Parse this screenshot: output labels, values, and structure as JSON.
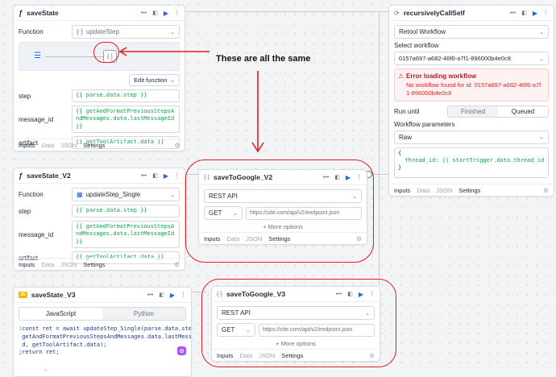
{
  "cards": {
    "saveState": {
      "title": "saveState",
      "function_label": "Function",
      "function_value": "updateStep",
      "edit_function": "Edit function →",
      "rows": [
        {
          "label": "step",
          "value": "{{ parse.data.step }}"
        },
        {
          "label": "message_id",
          "value": "{{ getAndFormatPreviousStepsAndMessages.data.lastMessageId }}"
        },
        {
          "label": "artifact",
          "value": "{{ getToolArtifact.data }}"
        }
      ]
    },
    "saveState_V2": {
      "title": "saveState_V2",
      "function_label": "Function",
      "function_value": "updateStep_Single",
      "rows": [
        {
          "label": "step",
          "value": "{{ parse.data.step }}"
        },
        {
          "label": "message_id",
          "value": "{{ getAndFormatPreviousStepsAndMessages.data.lastMessageId }}"
        },
        {
          "label": "artifact",
          "value": "{{ getToolArtifact.data }}"
        }
      ]
    },
    "saveState_V3": {
      "title": "saveState_V3",
      "tab_js": "JavaScript",
      "tab_py": "Python",
      "code_lines": [
        "const ret = await updateStep_Single(parse.data.step,",
        "getAndFormatPreviousStepsAndMessages.data.lastMessageI",
        "d, getToolArtifact.data);",
        "return ret;"
      ],
      "line_numbers": [
        "1",
        "",
        "",
        "2"
      ]
    },
    "saveToGoogle_V2": {
      "title": "saveToGoogle_V2",
      "resource": "REST API",
      "method": "GET",
      "url_placeholder": "https://site.com/api/v2/endpoint.json",
      "more_options": "More options"
    },
    "saveToGoogle_V3": {
      "title": "saveToGoogle_V3",
      "resource": "REST API",
      "method": "GET",
      "url_placeholder": "https://site.com/api/v2/endpoint.json",
      "more_options": "More options"
    },
    "recursivelyCallSelf": {
      "title": "recursivelyCallSelf",
      "resource": "Retool Workflow",
      "select_workflow_label": "Select workflow",
      "workflow_id": "0157a697-a682-46f6-a7f1-896000b4e0c8",
      "error_title": "Error loading workflow",
      "error_message": "No workflow found for id: 0157a697-a682-46f6-a7f1-896000b4e0c8",
      "run_until_label": "Run until",
      "run_until_options": [
        "Finished",
        "Queued"
      ],
      "run_until_selected": "Queued",
      "params_label": "Workflow parameters",
      "params_format": "Raw",
      "params_code": [
        "{",
        "  thread_id: {{ startTrigger.data.thread_id }}",
        "}"
      ]
    }
  },
  "bottom_tabs": [
    "Inputs",
    "Data",
    "JSON",
    "Settings"
  ],
  "annotation": "These are all the same",
  "colors": {
    "annotation_red": "#e11d1d",
    "accent_blue": "#2563eb",
    "error_red": "#dc2626",
    "binding_green": "#16a34a"
  }
}
